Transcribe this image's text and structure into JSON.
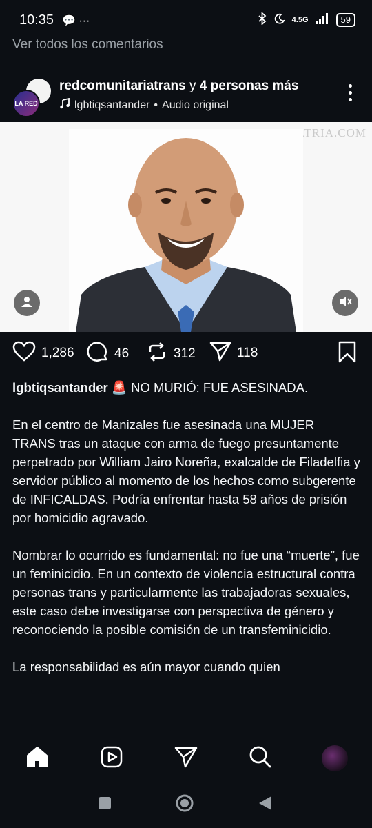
{
  "status_bar": {
    "time": "10:35",
    "left_icons": "💬 ···",
    "network": "4.5G",
    "battery": "59"
  },
  "comments_link": "Ver todos los comentarios",
  "post": {
    "username": "redcomunitariatrans",
    "collab_connector": " y ",
    "collab_others": "4 personas más",
    "audio_account": "lgbtiqsantander",
    "audio_separator": " • ",
    "audio_label": "Audio original",
    "avatar_text": "LA RED",
    "image_watermark": "LA PATRIA.COM"
  },
  "actions": {
    "likes": "1,286",
    "comments": "46",
    "reposts": "312",
    "shares": "118"
  },
  "caption": {
    "username": "lgbtiqsantander",
    "emoji": "🚨",
    "headline": " NO MURIÓ: FUE ASESINADA.",
    "paragraphs": [
      "En el centro de Manizales fue asesinada una MUJER TRANS tras un ataque con arma de fuego presuntamente perpetrado por William Jairo Noreña, exalcalde de Filadelfia y servidor público al momento de los hechos como subgerente de INFICALDAS. Podría enfrentar hasta 58 años de prisión por homicidio agravado.",
      "Nombrar lo ocurrido es fundamental: no fue una “muerte”, fue un feminicidio. En un contexto de violencia estructural contra personas trans y particularmente las trabajadoras sexuales, este caso debe investigarse con perspectiva de género y reconociendo la posible comisión de un transfeminicidio.",
      "La responsabilidad es aún mayor cuando quien"
    ]
  },
  "colors": {
    "background": "#0c0f14",
    "text": "#f3f5f7",
    "muted": "#9aa0a6"
  }
}
